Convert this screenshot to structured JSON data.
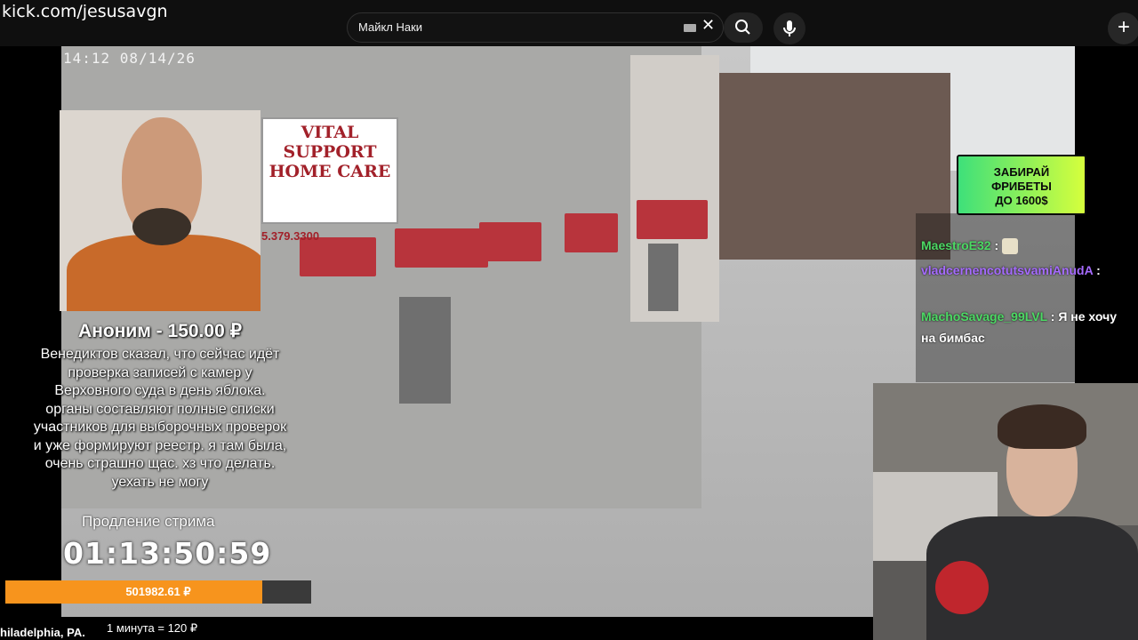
{
  "browser": {
    "channel_url": "kick.com/jesusavgn",
    "search_value": "Майкл Наки"
  },
  "stream": {
    "camera_timestamp": "14:12 08/14/26",
    "location": "hiladelphia, PA.",
    "sign_title": "VITAL SUPPORT HOME CARE",
    "sign_phone": "5.379.3300"
  },
  "donation": {
    "donor_line": "Аноним - 150.00 ₽",
    "message_lines": [
      "Венедиктов сказал, что сейчас идёт",
      "проверка записей с камер у",
      "Верховного суда в день яблока.",
      "органы составляют полные списки",
      "участников для выборочных проверок",
      "и уже формируют реестр. я там была,",
      "очень страшно щас. хз что делать.",
      "уехать не могу"
    ]
  },
  "subathon": {
    "label": "Продление стрима",
    "timer": "01:13:50:59",
    "progress_text": "501982.61 ₽",
    "progress_fraction": 0.84,
    "rate": "1 минута = 120 ₽",
    "accent": "#f7941d"
  },
  "ad": {
    "lines": [
      "ЗАБИРАЙ",
      "ФРИБЕТЫ",
      "ДО 1600$"
    ]
  },
  "chat": {
    "messages": [
      {
        "user": "MaestroE32",
        "text": "",
        "user_color": "#4cd964"
      },
      {
        "user": "vladcernencotutsvamiAnudA",
        "text": "",
        "user_color": "#a66bff"
      },
      {
        "user": "MachoSavage_99LVL",
        "text": "Я не хочу",
        "user_color": "#4cd964"
      },
      {
        "user": "",
        "text": "на бимбас",
        "user_color": "#ffffff"
      }
    ]
  }
}
